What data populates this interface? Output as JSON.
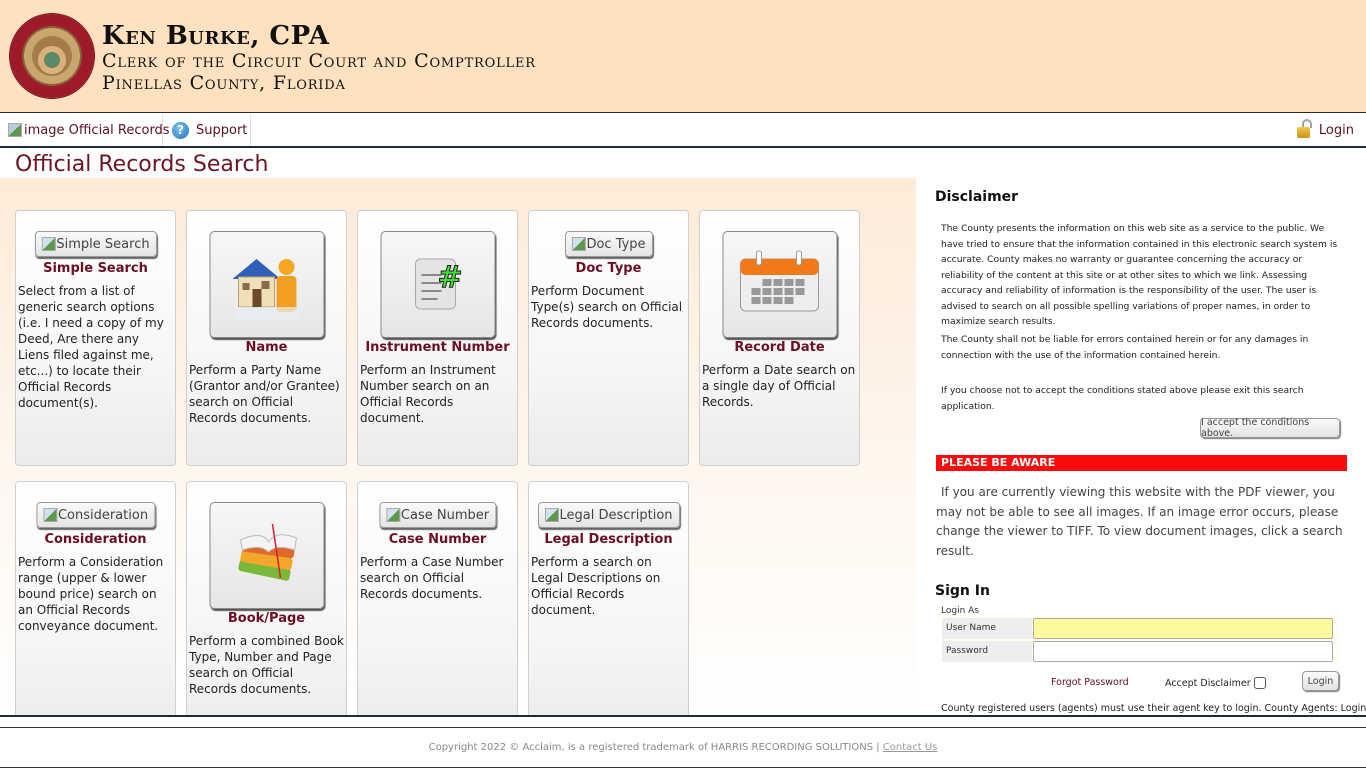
{
  "banner": {
    "line1": "Ken Burke, CPA",
    "line2": "Clerk of the Circuit Court and Comptroller",
    "line3": "Pinellas County, Florida",
    "seal_icon": "county-seal-logo"
  },
  "navbar": {
    "official_records": "image Official Records",
    "support": "Support",
    "login": "Login"
  },
  "page_title": "Official Records Search",
  "tiles": [
    {
      "key": "simple-search",
      "button_label": "Simple Search",
      "title": "Simple Search",
      "icon": "broken-image",
      "description": "Select from a list of generic search options (i.e. I need a copy of my Deed, Are there any Liens filed against me, etc...) to locate their Official Records document(s)."
    },
    {
      "key": "name",
      "button_label": "",
      "title": "Name",
      "icon": "house-person-icon",
      "description": "Perform a Party Name (Grantor and/or Grantee) search on Official Records documents."
    },
    {
      "key": "instrument-number",
      "button_label": "",
      "title": "Instrument Number",
      "icon": "document-hash-icon",
      "description": "Perform an Instrument Number search on an Official Records document."
    },
    {
      "key": "doc-type",
      "button_label": "Doc Type",
      "title": "Doc Type",
      "icon": "broken-image",
      "description": "Perform Document Type(s) search on Official Records documents."
    },
    {
      "key": "record-date",
      "button_label": "",
      "title": "Record Date",
      "icon": "calendar-icon",
      "description": "Perform a Date search on a single day of Official Records."
    },
    {
      "key": "consideration",
      "button_label": "Consideration",
      "title": "Consideration",
      "icon": "broken-image",
      "description": "Perform a Consideration range (upper & lower bound price) search on an Official Records conveyance document."
    },
    {
      "key": "book-page",
      "button_label": "",
      "title": "Book/Page",
      "icon": "books-icon",
      "description": "Perform a combined Book Type, Number and Page search on Official Records documents."
    },
    {
      "key": "case-number",
      "button_label": "Case Number",
      "title": "Case Number",
      "icon": "broken-image",
      "description": "Perform a Case Number search on Official Records documents."
    },
    {
      "key": "legal-description",
      "button_label": "Legal Description",
      "title": "Legal Description",
      "icon": "broken-image",
      "description": "Perform a search on Legal Descriptions on Official Records document."
    }
  ],
  "disclaimer": {
    "title": "Disclaimer",
    "p1": "The County presents the information on this web site as a service to the public. We have tried to ensure that the information contained in this electronic search system is accurate. County makes no warranty or guarantee concerning the accuracy or reliability of the content at this site or at other sites to which we link. Assessing accuracy and reliability of information is the responsibility of the user. The user is advised to search on all possible spelling variations of proper names, in order to maximize search results.",
    "p2": "The County shall not be liable for errors contained herein or for any damages in connection with the use of the information contained herein.",
    "p3": "If you choose not to accept the conditions stated above please exit this search application.",
    "accept_button": "I accept the conditions above."
  },
  "aware": {
    "header": "PLEASE BE AWARE",
    "text": "If you are currently viewing this website with the PDF viewer, you may not be able to see all images. If an image error occurs, please change the viewer to TIFF. To view document images, click a search result.",
    "color": "#f90c0c"
  },
  "signin": {
    "title": "Sign In",
    "login_as": "Login As",
    "username_label": "User Name",
    "username_value": "",
    "password_label": "Password",
    "password_value": "",
    "forgot_password": "Forgot Password",
    "accept_disclaimer": "Accept Disclaimer",
    "accept_disclaimer_checked": false,
    "login_button": "Login",
    "agent_note": "County registered users (agents) must use their agent key to login. County Agents: Login"
  },
  "footer": {
    "copyright": "Copyright 2022 © Acclaim, is a registered trademark of HARRIS RECORDING SOLUTIONS | ",
    "contact": "Contact Us"
  },
  "colors": {
    "banner_bg": "#fee2bf",
    "accent_maroon": "#6b0f23",
    "nav_rule": "#1e2b38"
  }
}
